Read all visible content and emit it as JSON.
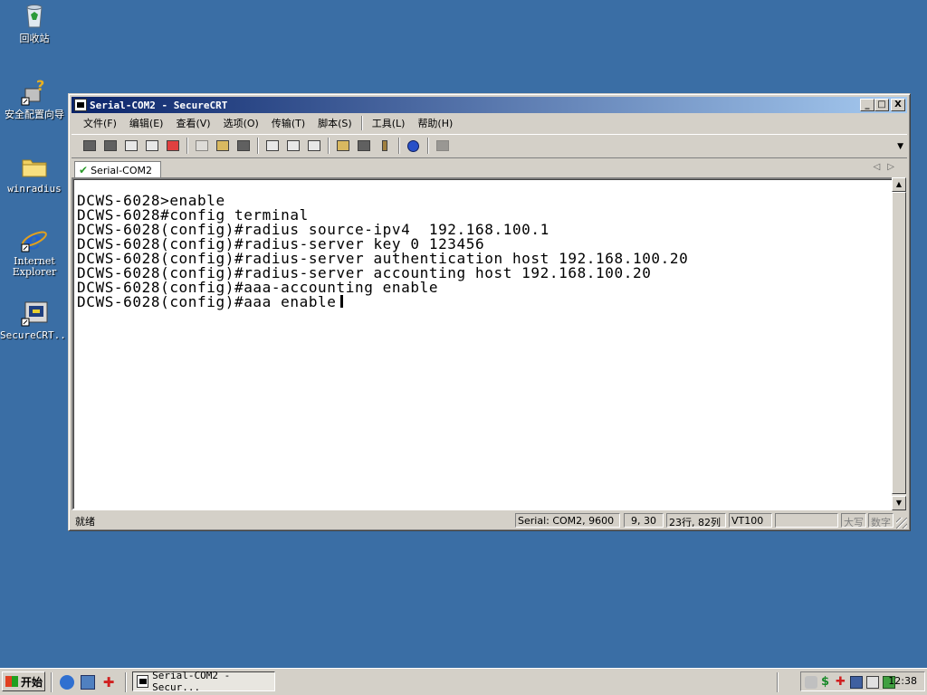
{
  "desktop": {
    "icons": [
      {
        "label": "回收站"
      },
      {
        "label": "安全配置向导"
      },
      {
        "label": "winradius"
      },
      {
        "label": "Internet Explorer"
      },
      {
        "label": "SecureCRT..."
      }
    ]
  },
  "window": {
    "title": "Serial-COM2 - SecureCRT",
    "controls": {
      "minimize": "_",
      "maximize": "□",
      "close": "X"
    },
    "menu": [
      "文件(F)",
      "编辑(E)",
      "查看(V)",
      "选项(O)",
      "传输(T)",
      "脚本(S)",
      "工具(L)",
      "帮助(H)"
    ],
    "tab": {
      "label": "Serial-COM2"
    },
    "terminal_lines": [
      "DCWS-6028>enable",
      "DCWS-6028#config terminal",
      "DCWS-6028(config)#radius source-ipv4  192.168.100.1",
      "DCWS-6028(config)#radius-server key 0 123456",
      "DCWS-6028(config)#radius-server authentication host 192.168.100.20",
      "DCWS-6028(config)#radius-server accounting host 192.168.100.20",
      "DCWS-6028(config)#aaa-accounting enable",
      "DCWS-6028(config)#aaa enable"
    ],
    "status": {
      "ready": "就绪",
      "connection": "Serial: COM2, 9600",
      "cursor_pos": "9, 30",
      "size": "23行, 82列",
      "emulation": "VT100",
      "blank": "",
      "caps": "大写",
      "num": "数字"
    }
  },
  "taskbar": {
    "start_label": "开始",
    "task_label": "Serial-COM2 - Secur...",
    "clock": "12:38"
  }
}
